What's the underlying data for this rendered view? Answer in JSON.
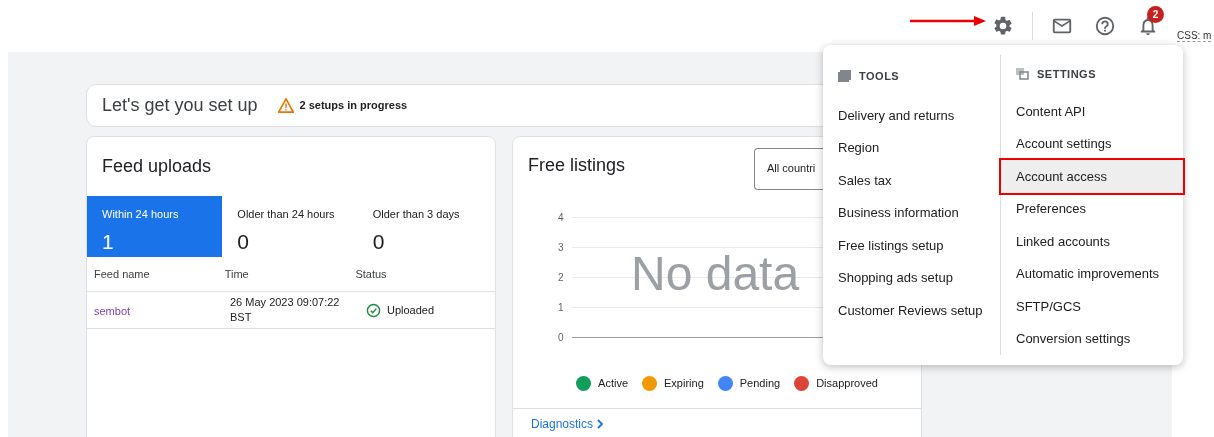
{
  "top_bar": {
    "notification_count": "2",
    "overlay_label": "CSS: m"
  },
  "setup_banner": {
    "title": "Let's get you set up",
    "status": "2 setups in progress"
  },
  "feed_uploads": {
    "title": "Feed uploads",
    "tabs": [
      {
        "label": "Within 24 hours",
        "count": "1",
        "selected": true
      },
      {
        "label": "Older than 24 hours",
        "count": "0",
        "selected": false
      },
      {
        "label": "Older than 3 days",
        "count": "0",
        "selected": false
      }
    ],
    "table": {
      "columns": [
        "Feed name",
        "Time",
        "Status"
      ],
      "rows": [
        {
          "feed_name": "sembot",
          "time": "26 May 2023 09:07:22 BST",
          "status": "Uploaded"
        }
      ]
    }
  },
  "free_listings": {
    "title": "Free listings",
    "country_filter": "All countri",
    "y_ticks": [
      "4",
      "3",
      "2",
      "1",
      "0"
    ],
    "empty_message": "No data",
    "legend": [
      {
        "label": "Active",
        "color": "#0f9d58"
      },
      {
        "label": "Expiring",
        "color": "#f29900"
      },
      {
        "label": "Pending",
        "color": "#4285f4"
      },
      {
        "label": "Disapproved",
        "color": "#db4437"
      }
    ],
    "footer_link": "Diagnostics"
  },
  "menu": {
    "sections": [
      {
        "kind": "tools",
        "title": "TOOLS",
        "items": [
          {
            "label": "Delivery and returns",
            "selected": false,
            "annotated": false
          },
          {
            "label": "Region",
            "selected": false,
            "annotated": false
          },
          {
            "label": "Sales tax",
            "selected": false,
            "annotated": false
          },
          {
            "label": "Business information",
            "selected": false,
            "annotated": false
          },
          {
            "label": "Free listings setup",
            "selected": false,
            "annotated": false
          },
          {
            "label": "Shopping ads setup",
            "selected": false,
            "annotated": false
          },
          {
            "label": "Customer Reviews setup",
            "selected": false,
            "annotated": false
          }
        ]
      },
      {
        "kind": "settings",
        "title": "SETTINGS",
        "items": [
          {
            "label": "Content API",
            "selected": false,
            "annotated": false
          },
          {
            "label": "Account settings",
            "selected": false,
            "annotated": false
          },
          {
            "label": "Account access",
            "selected": true,
            "annotated": true
          },
          {
            "label": "Preferences",
            "selected": false,
            "annotated": false
          },
          {
            "label": "Linked accounts",
            "selected": false,
            "annotated": false
          },
          {
            "label": "Automatic improvements",
            "selected": false,
            "annotated": false
          },
          {
            "label": "SFTP/GCS",
            "selected": false,
            "annotated": false
          },
          {
            "label": "Conversion settings",
            "selected": false,
            "annotated": false
          }
        ]
      }
    ]
  }
}
